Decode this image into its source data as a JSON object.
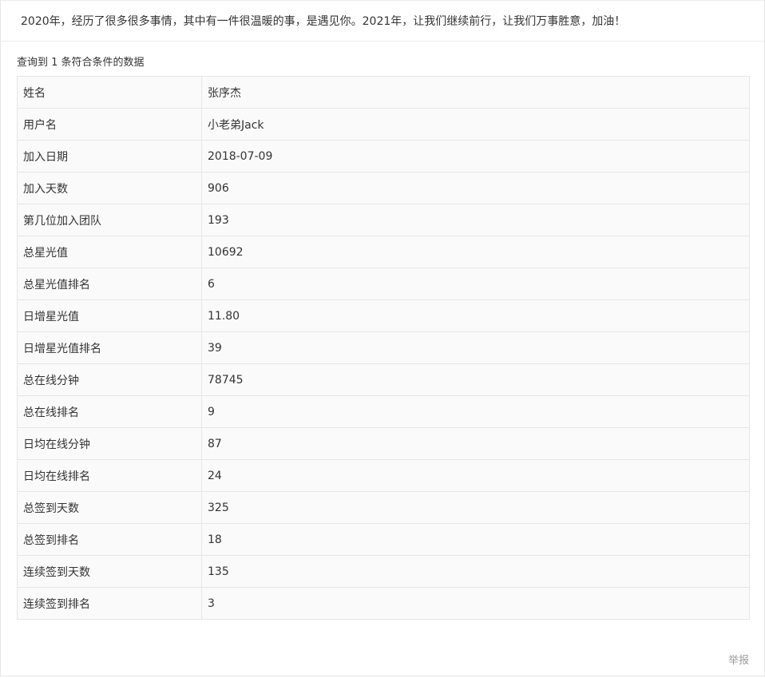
{
  "banner": {
    "message": "2020年，经历了很多很多事情，其中有一件很温暖的事，是遇见你。2021年，让我们继续前行，让我们万事胜意，加油！"
  },
  "result": {
    "count_text": "查询到 1 条符合条件的数据"
  },
  "table": {
    "rows": [
      {
        "key": "姓名",
        "value": "张序杰"
      },
      {
        "key": "用户名",
        "value": "小老弟Jack"
      },
      {
        "key": "加入日期",
        "value": "2018-07-09"
      },
      {
        "key": "加入天数",
        "value": "906"
      },
      {
        "key": "第几位加入团队",
        "value": "193"
      },
      {
        "key": "总星光值",
        "value": "10692"
      },
      {
        "key": "总星光值排名",
        "value": "6"
      },
      {
        "key": "日增星光值",
        "value": "11.80"
      },
      {
        "key": "日增星光值排名",
        "value": "39"
      },
      {
        "key": "总在线分钟",
        "value": "78745"
      },
      {
        "key": "总在线排名",
        "value": "9"
      },
      {
        "key": "日均在线分钟",
        "value": "87"
      },
      {
        "key": "日均在线排名",
        "value": "24"
      },
      {
        "key": "总签到天数",
        "value": "325"
      },
      {
        "key": "总签到排名",
        "value": "18"
      },
      {
        "key": "连续签到天数",
        "value": "135"
      },
      {
        "key": "连续签到排名",
        "value": "3"
      }
    ]
  },
  "footer": {
    "report_label": "举报"
  },
  "colors": {
    "table_background": "#fafafa",
    "border": "#e6e6e6",
    "muted_text": "#999999"
  }
}
